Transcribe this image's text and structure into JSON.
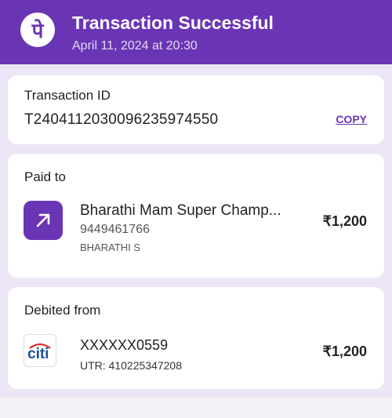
{
  "header": {
    "logo_glyph": "पे",
    "title": "Transaction Successful",
    "subtitle": "April 11, 2024 at 20:30",
    "color": "#6a35b4"
  },
  "transaction": {
    "label": "Transaction ID",
    "id": "T2404112030096235974550",
    "copy_label": "COPY"
  },
  "paid_to": {
    "label": "Paid to",
    "icon": "arrow-up-right-icon",
    "name": "Bharathi Mam Super Champ...",
    "phone": "9449461766",
    "holder": "BHARATHI S",
    "amount": "₹1,200"
  },
  "debited_from": {
    "label": "Debited from",
    "bank_logo_text": "citi",
    "account": "XXXXXX0559",
    "utr": "UTR: 410225347208",
    "amount": "₹1,200"
  }
}
